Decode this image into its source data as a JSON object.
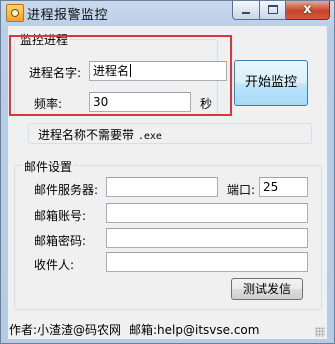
{
  "window": {
    "title": "进程报警监控",
    "close_glyph": "x"
  },
  "monitor_group": {
    "title": "监控进程",
    "process_name_label": "进程名字:",
    "process_name_value": "进程名",
    "frequency_label": "频率:",
    "frequency_value": "30",
    "frequency_unit": "秒",
    "start_button_label": "开始监控"
  },
  "hint": {
    "text_cn": "进程名称不需要带",
    "text_code": ".exe"
  },
  "mail_group": {
    "title": "邮件设置",
    "server_label": "邮件服务器:",
    "server_value": "",
    "port_label": "端口:",
    "port_value": "25",
    "account_label": "邮箱账号:",
    "account_value": "",
    "password_label": "邮箱密码:",
    "password_value": "",
    "recipient_label": "收件人:",
    "recipient_value": "",
    "test_button_label": "测试发信"
  },
  "status_bar": {
    "author": "作者:小渣渣@码农网",
    "email": "邮箱:help@itsvse.com"
  },
  "colors": {
    "highlight_border": "#d9363e",
    "window_frame": "#b9cde6",
    "client_bg": "#f0f0f0"
  }
}
